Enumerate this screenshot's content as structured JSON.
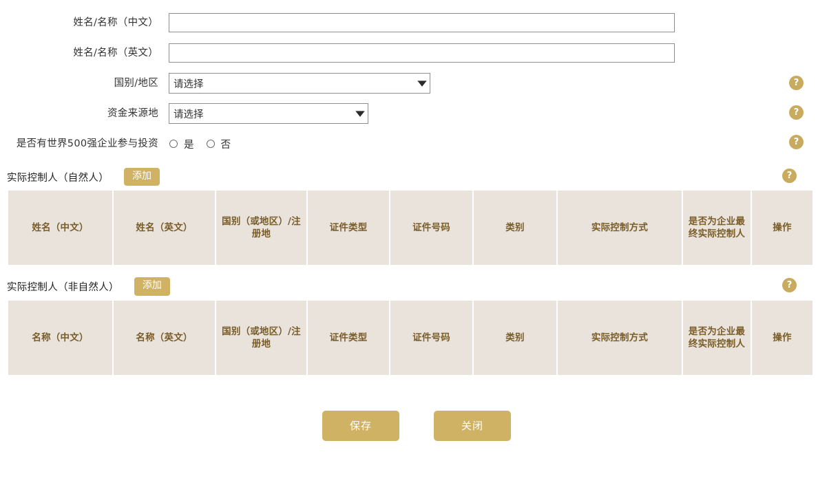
{
  "form": {
    "fields": [
      {
        "label": "姓名/名称（中文）",
        "type": "text",
        "value": "",
        "placeholder": "",
        "has_help": false
      },
      {
        "label": "姓名/名称（英文）",
        "type": "text",
        "value": "",
        "placeholder": "",
        "has_help": false
      },
      {
        "label": "国别/地区",
        "type": "select",
        "value": "请选择",
        "has_help": true
      },
      {
        "label": "资金来源地",
        "type": "select",
        "value": "请选择",
        "has_help": true
      },
      {
        "label": "是否有世界500强企业参与投资",
        "type": "radio",
        "options": [
          "是",
          "否"
        ],
        "selected": "",
        "has_help": true
      }
    ]
  },
  "help_icon": {
    "glyph": "?",
    "name": "help-icon",
    "color": "#c8ab5e"
  },
  "sections": [
    {
      "title": "实际控制人（自然人）",
      "add_label": "添加",
      "help": "?",
      "columns": [
        "姓名（中文）",
        "姓名（英文）",
        "国别（或地区）/注册地",
        "证件类型",
        "证件号码",
        "类别",
        "实际控制方式",
        "是否为企业最终实际控制人",
        "操作"
      ],
      "rows": []
    },
    {
      "title": "实际控制人（非自然人）",
      "add_label": "添加",
      "help": "?",
      "columns": [
        "名称（中文）",
        "名称（英文）",
        "国别（或地区）/注册地",
        "证件类型",
        "证件号码",
        "类别",
        "实际控制方式",
        "是否为企业最终实际控制人",
        "操作"
      ],
      "rows": []
    }
  ],
  "footer": {
    "save_label": "保存",
    "close_label": "关闭"
  },
  "colors": {
    "accent": "#cfb263",
    "table_header_bg": "#e9e3db",
    "table_header_text": "#7a5c28",
    "help_badge": "#c8ab5e"
  }
}
